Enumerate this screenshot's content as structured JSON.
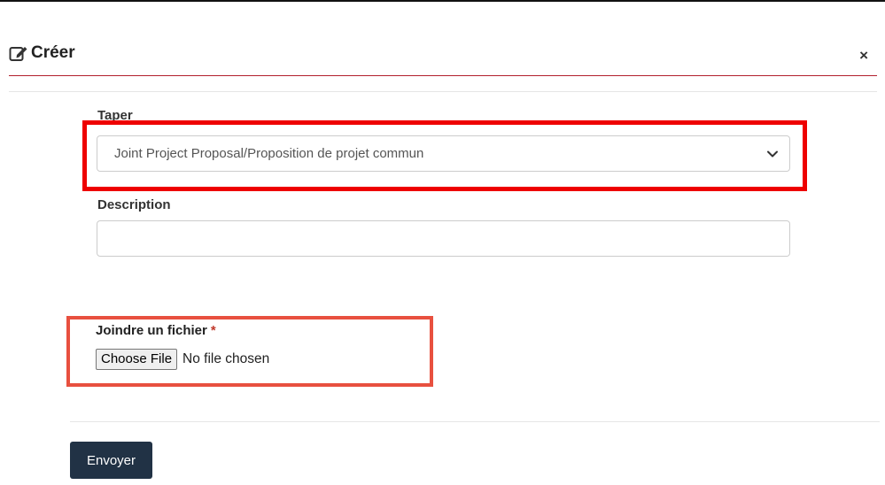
{
  "modal": {
    "title": "Créer",
    "title_icon": "edit-icon",
    "close_label": "×",
    "accent_color": "#b21f2d"
  },
  "form": {
    "type_label": "Taper",
    "type_selected": "Joint Project Proposal/Proposition de projet commun",
    "description_label": "Description",
    "description_value": "",
    "file_label": "Joindre un fichier",
    "file_required_marker": "*",
    "choose_file_label": "Choose File",
    "file_status": "No file chosen"
  },
  "footer": {
    "submit_label": "Envoyer",
    "submit_color": "#213245"
  },
  "annotations": {
    "highlight_color_1": "#ee0000",
    "highlight_color_2": "#e8503f"
  }
}
